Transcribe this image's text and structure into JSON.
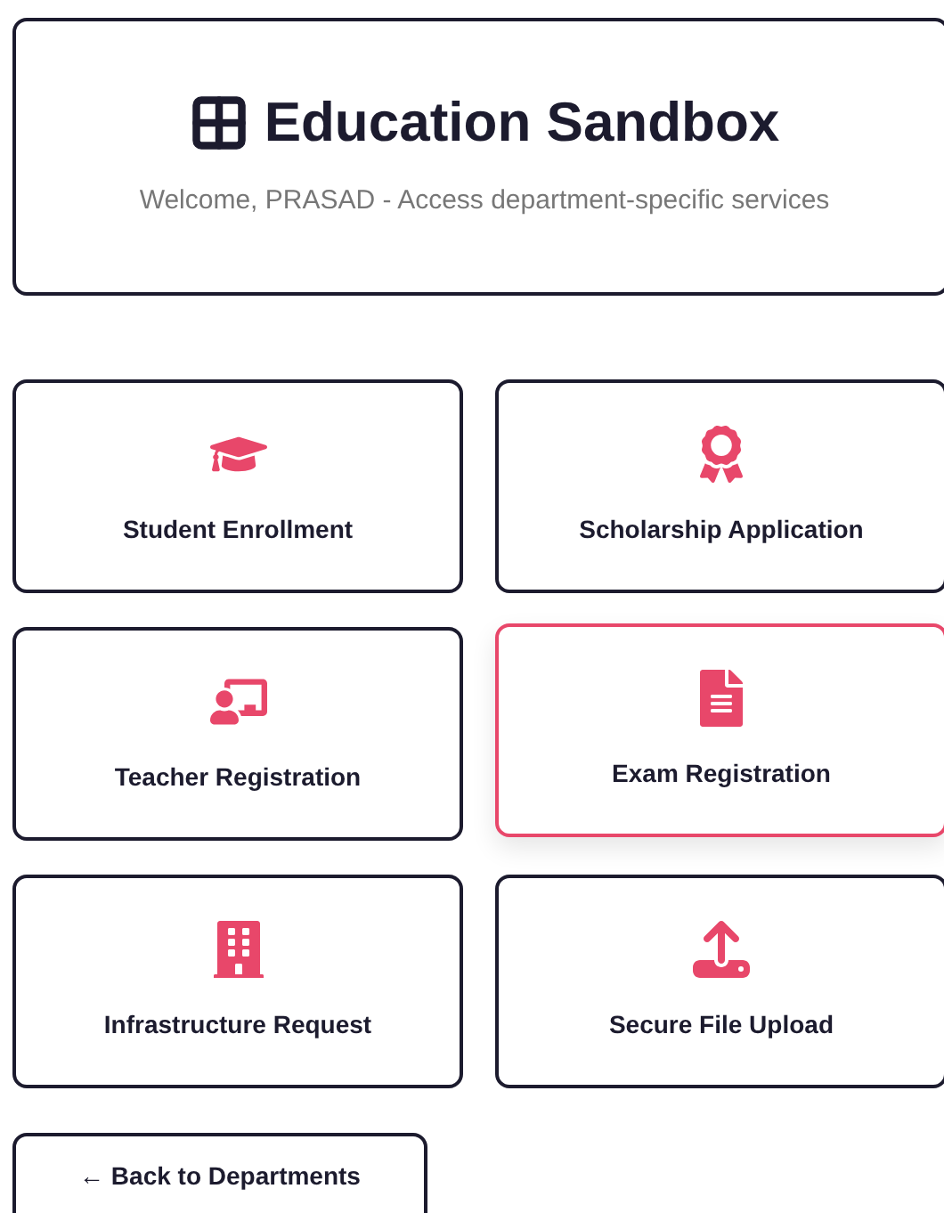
{
  "header": {
    "title": "Education Sandbox",
    "subtitle": "Welcome, PRASAD - Access department-specific services"
  },
  "services": [
    {
      "kind": "graduation",
      "label": "Student Enrollment",
      "selected": false
    },
    {
      "kind": "award",
      "label": "Scholarship Application",
      "selected": false
    },
    {
      "kind": "teacher",
      "label": "Teacher Registration",
      "selected": false
    },
    {
      "kind": "document",
      "label": "Exam Registration",
      "selected": true
    },
    {
      "kind": "building",
      "label": "Infrastructure Request",
      "selected": false
    },
    {
      "kind": "upload",
      "label": "Secure File Upload",
      "selected": false
    }
  ],
  "back_button": {
    "label": "← Back to Departments"
  }
}
